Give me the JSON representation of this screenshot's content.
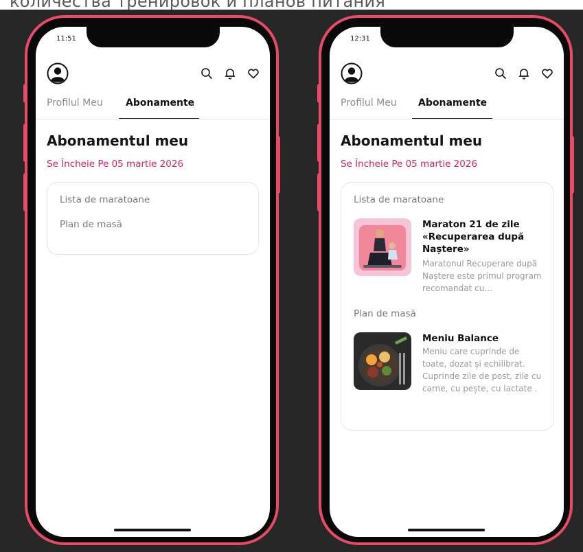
{
  "caption": "количества тренировок и планов питания",
  "left_phone": {
    "time": "11:51",
    "tabs": {
      "profile": "Profilul Meu",
      "subscriptions": "Abonamente"
    },
    "heading": "Abonamentul meu",
    "ends": "Se Încheie Pe 05 martie 2026",
    "sections": {
      "marathons": "Lista de maratoane",
      "meal_plan": "Plan de masă"
    }
  },
  "right_phone": {
    "time": "12:31",
    "tabs": {
      "profile": "Profilul Meu",
      "subscriptions": "Abonamente"
    },
    "heading": "Abonamentul meu",
    "ends": "Se Încheie Pe 05 martie 2026",
    "sections": {
      "marathons": "Lista de maratoane",
      "meal_plan": "Plan de masă"
    },
    "marathon": {
      "title": "Maraton 21 de zile «Recuperarea după Naștere»",
      "description": "Maratonul Recuperare după Naștere este primul program recomandat cu..."
    },
    "meal": {
      "title": "Meniu Balance",
      "description": "Meniu care cuprinde de toate, dozat și echilibrat. Cuprinde zile de post, zile cu carne, cu pește, cu lactate ."
    }
  },
  "colors": {
    "frame": "#e84a68",
    "accent_text": "#d61f69"
  },
  "icons": [
    "profile-avatar-icon",
    "search-icon",
    "bell-icon",
    "heart-icon"
  ]
}
